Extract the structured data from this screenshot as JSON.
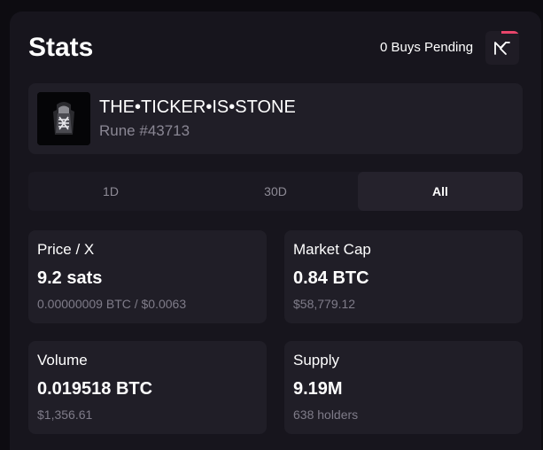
{
  "header": {
    "title": "Stats",
    "pending_text": "0 Buys Pending",
    "logo_icon": "magic-eden-logo-icon",
    "accent_color": "#e8456b"
  },
  "rune": {
    "name": "THE•TICKER•IS•STONE",
    "id_label": "Rune #43713",
    "thumbnail_icon": "rune-thumbnail-icon"
  },
  "tabs": [
    {
      "label": "1D",
      "active": false
    },
    {
      "label": "30D",
      "active": false
    },
    {
      "label": "All",
      "active": true
    }
  ],
  "stats": {
    "price": {
      "label": "Price / X",
      "value": "9.2 sats",
      "sub": "0.00000009 BTC / $0.0063"
    },
    "market_cap": {
      "label": "Market Cap",
      "value": "0.84 BTC",
      "sub": "$58,779.12"
    },
    "volume": {
      "label": "Volume",
      "value": "0.019518 BTC",
      "sub": "$1,356.61"
    },
    "supply": {
      "label": "Supply",
      "value": "9.19M",
      "sub": "638 holders"
    }
  }
}
